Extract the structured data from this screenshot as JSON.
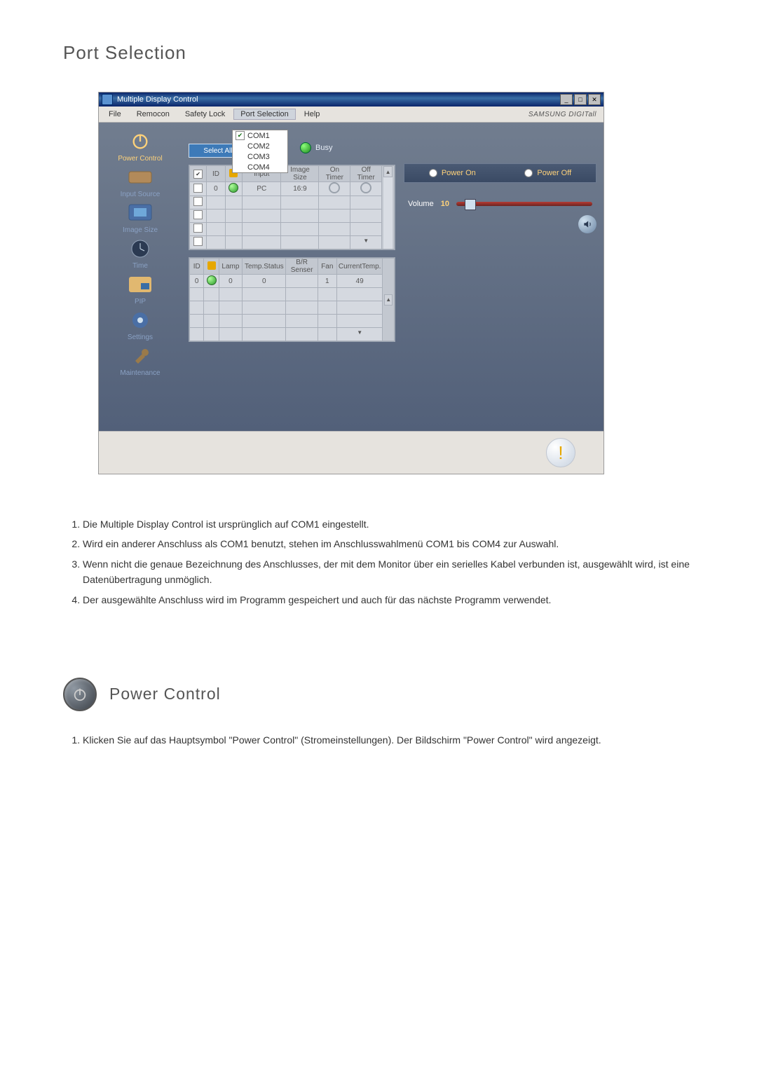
{
  "section1_title": "Port Selection",
  "section2_title": "Power Control",
  "doc_list1": [
    "Die Multiple Display Control ist ursprünglich auf COM1 eingestellt.",
    "Wird ein anderer Anschluss als COM1 benutzt, stehen im Anschlusswahlmenü COM1 bis COM4 zur Auswahl.",
    "Wenn nicht die genaue Bezeichnung des Anschlusses, der mit dem Monitor über ein serielles Kabel verbunden ist, ausgewählt wird, ist eine Datenübertragung unmöglich.",
    "Der ausgewählte Anschluss wird im Programm gespeichert und auch für das nächste Programm verwendet."
  ],
  "doc_list2": [
    "Klicken Sie auf das Hauptsymbol \"Power Control\" (Stromeinstellungen). Der Bildschirm \"Power Control\" wird angezeigt."
  ],
  "app": {
    "title": "Multiple Display Control",
    "brand": "SAMSUNG DIGITall",
    "menu": {
      "file": "File",
      "remocon": "Remocon",
      "safety": "Safety Lock",
      "port": "Port Selection",
      "help": "Help"
    },
    "ports": [
      "COM1",
      "COM2",
      "COM3",
      "COM4"
    ],
    "select_all": "Select All",
    "busy": "Busy",
    "sidebar": {
      "power": "Power Control",
      "input": "Input Source",
      "image": "Image Size",
      "time": "Time",
      "pip": "PIP",
      "settings": "Settings",
      "maint": "Maintenance"
    },
    "grid1": {
      "headers": {
        "id": "ID",
        "input": "Input",
        "image": "Image Size",
        "on": "On Timer",
        "off": "Off Timer"
      },
      "row": {
        "id": "0",
        "input": "PC",
        "image": "16:9"
      }
    },
    "grid2": {
      "headers": {
        "id": "ID",
        "status": "",
        "lamp": "Lamp",
        "temp": "Temp.Status",
        "br": "B/R Senser",
        "fan": "Fan",
        "cur": "CurrentTemp."
      },
      "row": {
        "id": "0",
        "lamp": "0",
        "temp": "0",
        "fan": "1",
        "cur": "49"
      }
    },
    "power_on": "Power On",
    "power_off": "Power Off",
    "volume_label": "Volume",
    "volume_value": "10"
  }
}
